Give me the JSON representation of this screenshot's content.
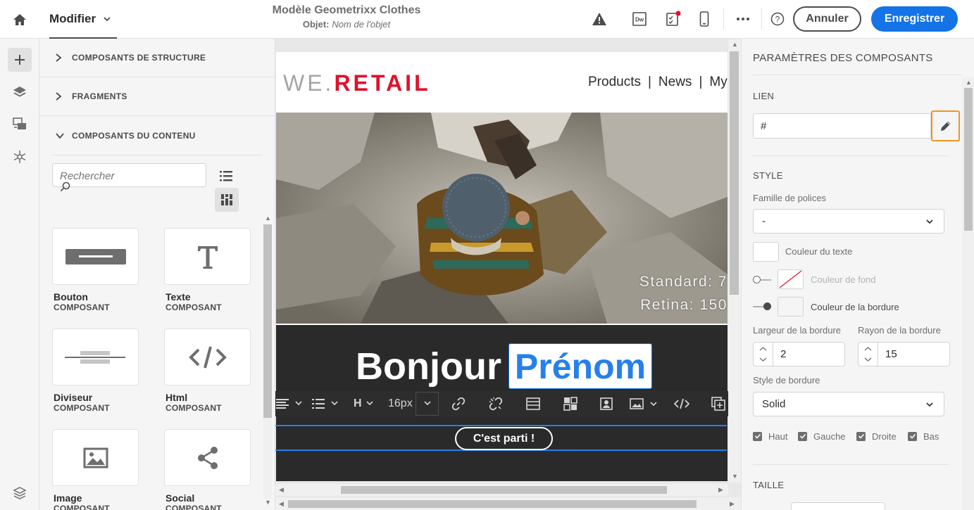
{
  "topbar": {
    "mode_label": "Modifier",
    "title": "Modèle Geometrixx Clothes",
    "object_label": "Objet:",
    "object_value": "Nom de l'objet",
    "cancel_label": "Annuler",
    "save_label": "Enregistrer",
    "icons": [
      "home-icon",
      "alert-icon",
      "dreamweaver-icon",
      "checklist-icon",
      "mobile-icon",
      "more-icon",
      "help-icon"
    ],
    "accent_color": "#1473e6"
  },
  "rail": {
    "icons": [
      "add-icon",
      "layers-icon",
      "assets-icon",
      "personalization-icon",
      "layers-stack-icon"
    ]
  },
  "components_panel": {
    "sections": [
      "COMPOSANTS DE STRUCTURE",
      "FRAGMENTS",
      "COMPOSANTS DU CONTENU"
    ],
    "search_placeholder": "Rechercher",
    "items": [
      {
        "name": "Bouton",
        "type": "COMPOSANT"
      },
      {
        "name": "Texte",
        "type": "COMPOSANT"
      },
      {
        "name": "Diviseur",
        "type": "COMPOSANT"
      },
      {
        "name": "Html",
        "type": "COMPOSANT"
      },
      {
        "name": "Image",
        "type": "COMPOSANT"
      },
      {
        "name": "Social",
        "type": "COMPOSANT"
      }
    ]
  },
  "email": {
    "logo_we": "WE",
    "logo_dot": ".",
    "logo_retail": "RETAIL",
    "nav": [
      "Products",
      "|",
      "News",
      "|",
      "My"
    ],
    "hero_caption_1": "Standard: 7",
    "hero_caption_2": "Retina: 150",
    "greeting": "Bonjour",
    "name_field": "Prénom",
    "cta_label": "C'est parti !",
    "brand_color": "#e0112b"
  },
  "rte_toolbar": {
    "heading_label": "H",
    "font_size": "16px"
  },
  "properties": {
    "title": "PARAMÈTRES DES COMPOSANTS",
    "link_section": "LIEN",
    "link_value": "#",
    "style_section": "STYLE",
    "font_family_label": "Famille de polices",
    "font_family_value": "-",
    "text_color_label": "Couleur du texte",
    "bg_color_label": "Couleur de fond",
    "border_color_label": "Couleur de la bordure",
    "border_width_label": "Largeur de la bordure",
    "border_width_value": "2",
    "border_radius_label": "Rayon de la bordure",
    "border_radius_value": "15",
    "border_style_label": "Style de bordure",
    "border_style_value": "Solid",
    "sides": [
      "Haut",
      "Gauche",
      "Droite",
      "Bas"
    ],
    "size_section": "TAILLE"
  }
}
